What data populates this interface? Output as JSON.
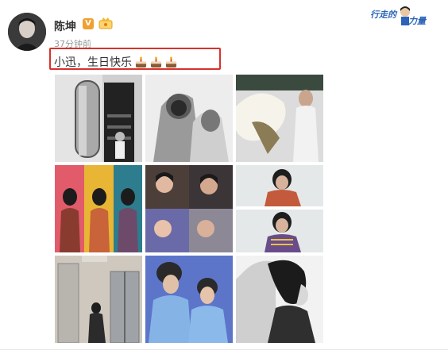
{
  "post": {
    "author": "陈坤",
    "vip_badge": "V",
    "time_ago": "37分钟前",
    "text": "小迅，生日快乐",
    "emoji": [
      "cake-emoji",
      "cake-emoji",
      "cake-emoji"
    ]
  },
  "brand": {
    "text_a": "行走的",
    "text_b": "力量"
  },
  "photos": [
    {
      "icon": "photo-door-bw"
    },
    {
      "icon": "photo-hooded-figures-bw"
    },
    {
      "icon": "photo-woman-white-feather"
    },
    {
      "icon": "photo-three-women-colorful"
    },
    {
      "icon": "photo-collage-selfies"
    },
    {
      "icon": "photo-woman-patterned-coat"
    },
    {
      "icon": "photo-woman-elevator"
    },
    {
      "icon": "photo-couple-blue-hoodies"
    },
    {
      "icon": "photo-woman-profile-bw"
    }
  ],
  "colors": {
    "highlight": "#d9312b",
    "brand_blue": "#2b64b8",
    "vip_orange": "#f0a030",
    "time_gray": "#999999"
  }
}
